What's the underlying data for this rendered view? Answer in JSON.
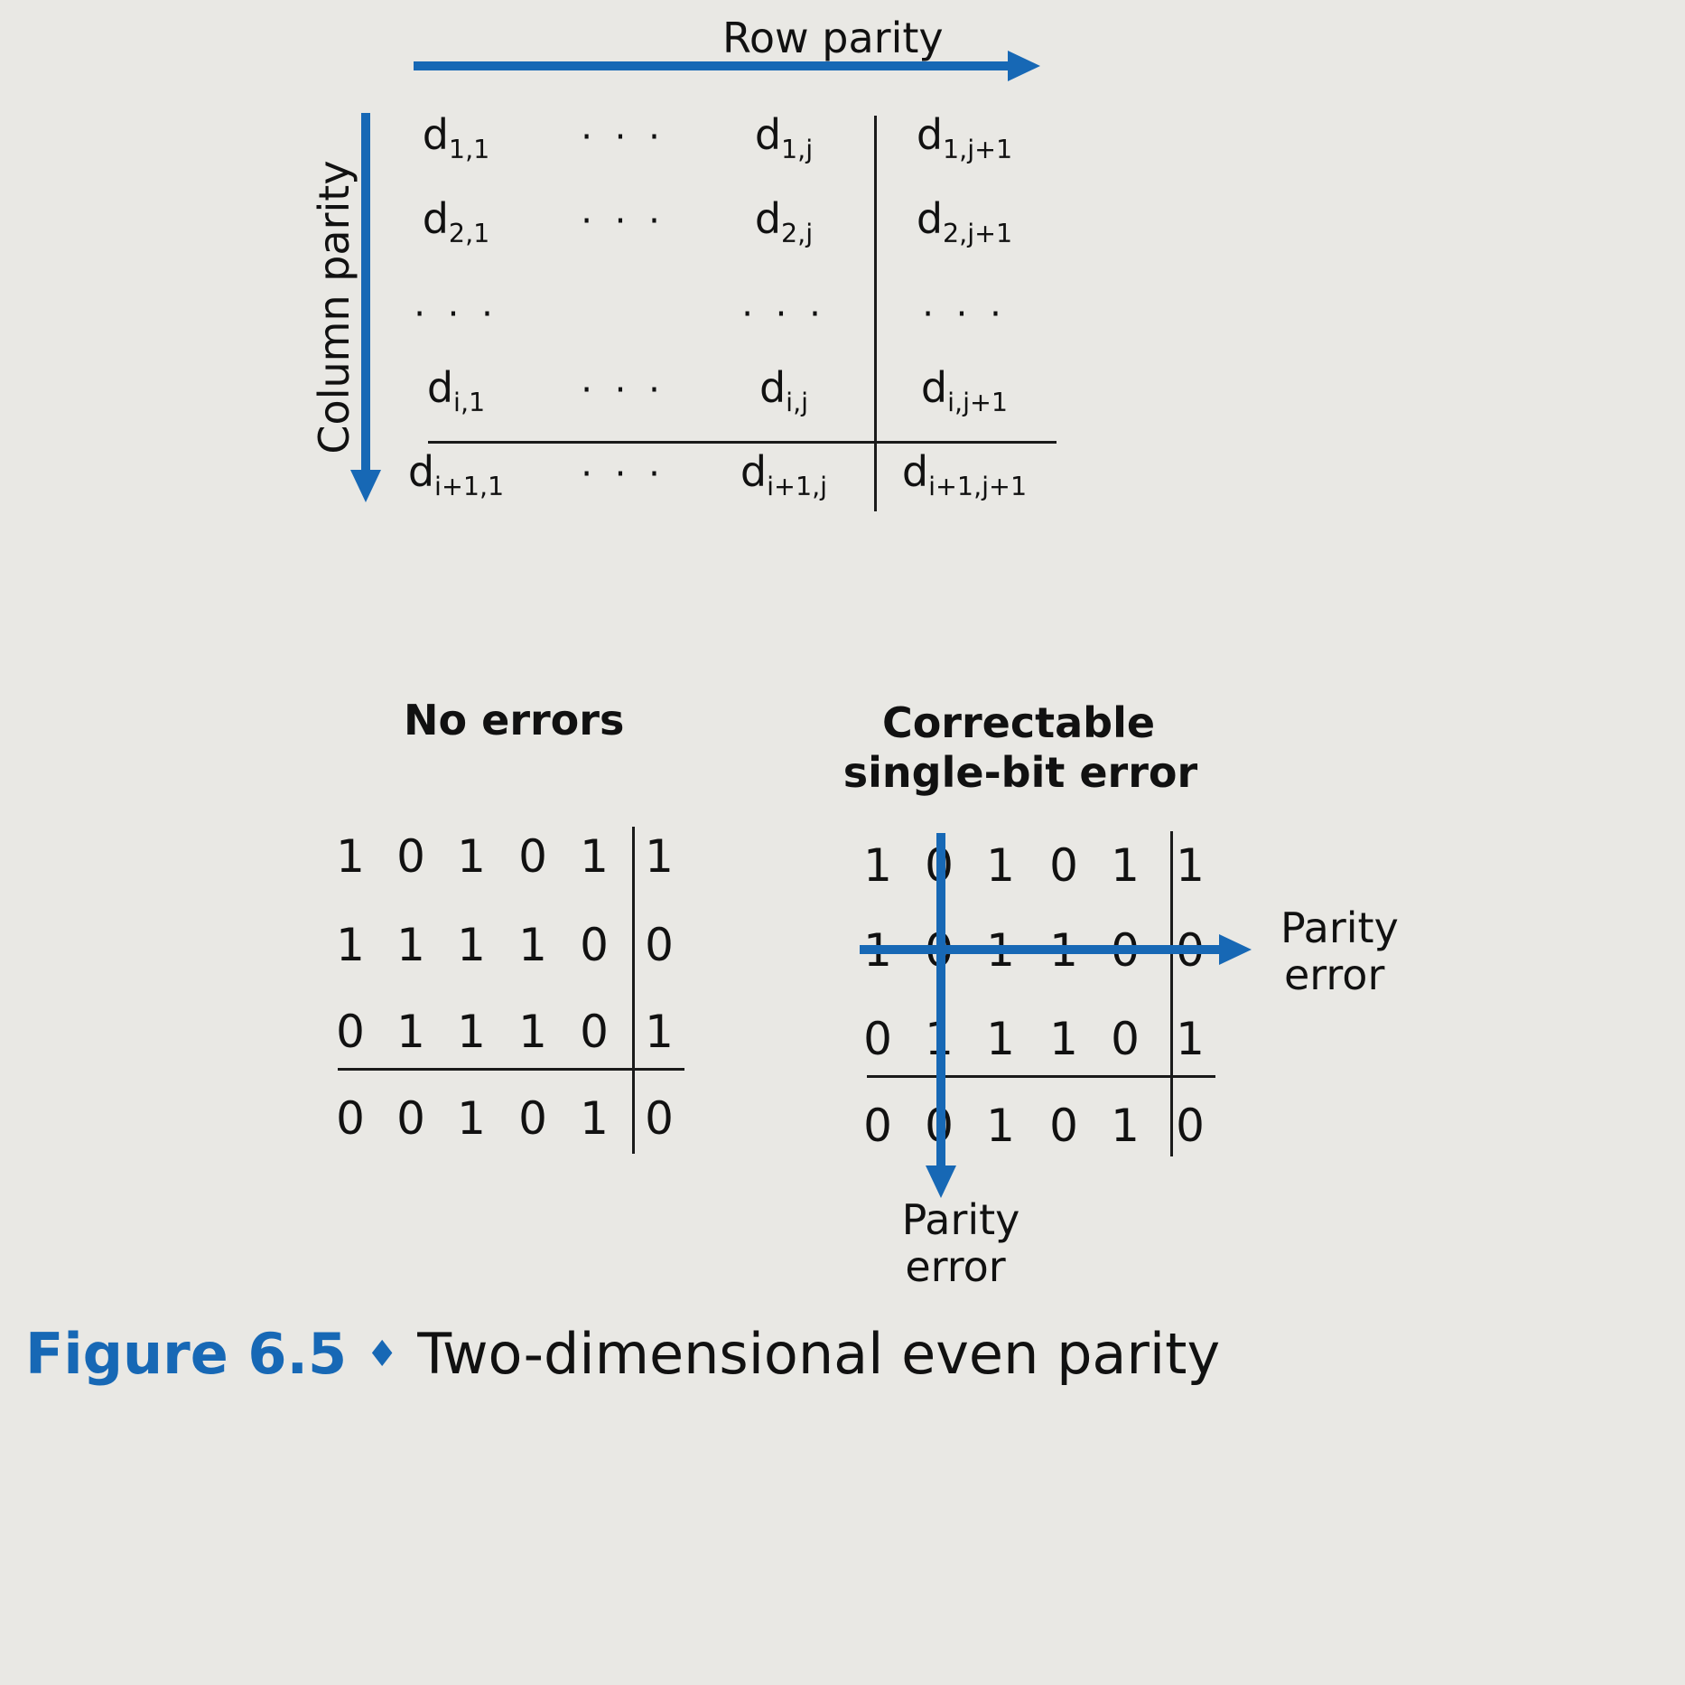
{
  "top": {
    "row_parity_label": "Row parity",
    "column_parity_label": "Column parity",
    "matrix": [
      [
        {
          "b": "d",
          "s": "1,1"
        },
        {
          "t": "· · ·"
        },
        {
          "b": "d",
          "s": "1,j"
        },
        {
          "b": "d",
          "s": "1,j+1"
        }
      ],
      [
        {
          "b": "d",
          "s": "2,1"
        },
        {
          "t": "· · ·"
        },
        {
          "b": "d",
          "s": "2,j"
        },
        {
          "b": "d",
          "s": "2,j+1"
        }
      ],
      [
        {
          "t": "· · ·"
        },
        {
          "t": ""
        },
        {
          "t": "· · ·"
        },
        {
          "t": "· · ·"
        }
      ],
      [
        {
          "b": "d",
          "s": "i,1"
        },
        {
          "t": "· · ·"
        },
        {
          "b": "d",
          "s": "i,j"
        },
        {
          "b": "d",
          "s": "i,j+1"
        }
      ],
      [
        {
          "b": "d",
          "s": "i+1,1"
        },
        {
          "t": "· · ·"
        },
        {
          "b": "d",
          "s": "i+1,j"
        },
        {
          "b": "d",
          "s": "i+1,j+1"
        }
      ]
    ]
  },
  "no_errors": {
    "title": "No errors",
    "rows": [
      [
        "1",
        "0",
        "1",
        "0",
        "1",
        "1"
      ],
      [
        "1",
        "1",
        "1",
        "1",
        "0",
        "0"
      ],
      [
        "0",
        "1",
        "1",
        "1",
        "0",
        "1"
      ],
      [
        "0",
        "0",
        "1",
        "0",
        "1",
        "0"
      ]
    ]
  },
  "correctable": {
    "title_line1": "Correctable",
    "title_line2": "single-bit error",
    "rows": [
      [
        "1",
        "0",
        "1",
        "0",
        "1",
        "1"
      ],
      [
        "1",
        "0",
        "1",
        "1",
        "0",
        "0"
      ],
      [
        "0",
        "1",
        "1",
        "1",
        "0",
        "1"
      ],
      [
        "0",
        "0",
        "1",
        "0",
        "1",
        "0"
      ]
    ],
    "row_parity_error_line1": "Parity",
    "row_parity_error_line2": "error",
    "col_parity_error_line1": "Parity",
    "col_parity_error_line2": "error"
  },
  "caption": {
    "figure_label": "Figure 6.5",
    "separator": "♦",
    "title": "Two-dimensional even parity"
  },
  "colors": {
    "accent": "#1768b5",
    "ink": "#111111",
    "paper": "#e9e8e4"
  }
}
